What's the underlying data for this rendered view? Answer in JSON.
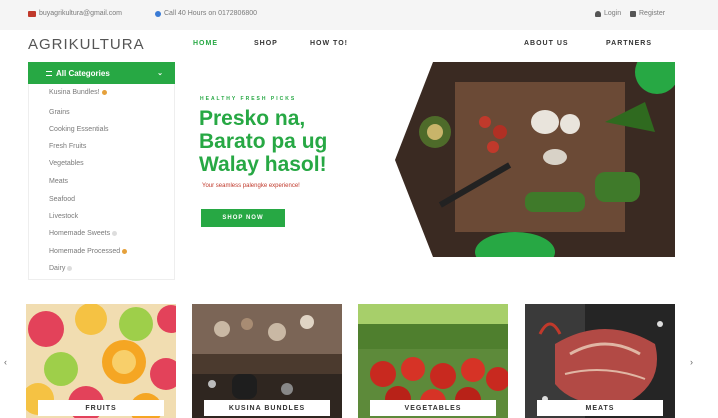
{
  "topbar": {
    "email": "buyagrikultura@gmail.com",
    "phone": "Call 40 Hours on 0172806800",
    "login_label": "Login",
    "register_label": "Register"
  },
  "header": {
    "logo": "AGRIKULTURA",
    "nav": [
      "HOME",
      "SHOP",
      "HOW TO!",
      "ABOUT US",
      "PARTNERS"
    ]
  },
  "sidebar": {
    "title": "All Categories",
    "items": [
      "Kusina Bundles!",
      "Grains",
      "Cooking Essentials",
      "Fresh Fruits",
      "Vegetables",
      "Meats",
      "Seafood",
      "Livestock",
      "Homemade Sweets",
      "Homemade Processed",
      "Dairy"
    ]
  },
  "hero": {
    "kicker": "HEALTHY FRESH PICKS",
    "title_lines": [
      "Presko na,",
      "Barato pa ug",
      "Walay hasol!"
    ],
    "subtitle": "Your seamless palengke experience!",
    "cta": "SHOP NOW"
  },
  "cards": [
    "FRUITS",
    "KUSINA BUNDLES",
    "VEGETABLES",
    "MEATS"
  ],
  "colors": {
    "brand_green": "#27a844",
    "accent_red": "#c0392b"
  }
}
